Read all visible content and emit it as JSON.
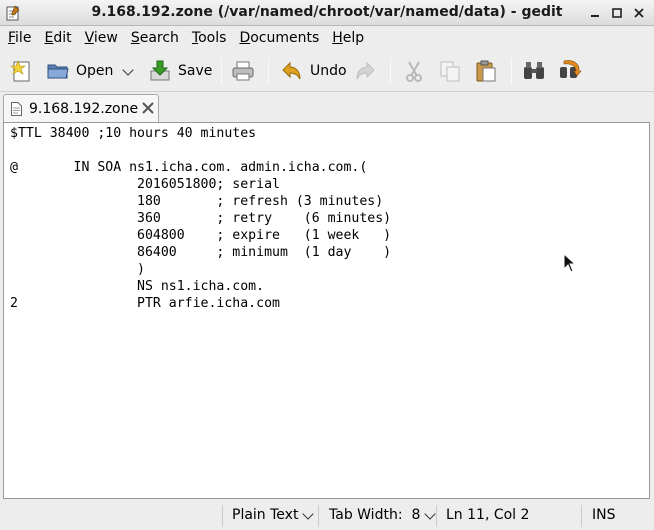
{
  "window": {
    "title": "9.168.192.zone (/var/named/chroot/var/named/data) - gedit"
  },
  "menu": [
    {
      "label": "File",
      "mnemonic": "F",
      "rest": "ile"
    },
    {
      "label": "Edit",
      "mnemonic": "E",
      "rest": "dit"
    },
    {
      "label": "View",
      "mnemonic": "V",
      "rest": "iew"
    },
    {
      "label": "Search",
      "mnemonic": "S",
      "rest": "earch"
    },
    {
      "label": "Tools",
      "mnemonic": "T",
      "rest": "ools"
    },
    {
      "label": "Documents",
      "mnemonic": "D",
      "rest": "ocuments"
    },
    {
      "label": "Help",
      "mnemonic": "H",
      "rest": "elp"
    }
  ],
  "toolbar": {
    "open_label": "Open",
    "save_label": "Save",
    "undo_label": "Undo"
  },
  "tab": {
    "label": "9.168.192.zone"
  },
  "editor": {
    "lines": [
      "$TTL 38400 ;10 hours 40 minutes",
      "",
      "@       IN SOA ns1.icha.com. admin.icha.com.(",
      "                2016051800; serial",
      "                180       ; refresh (3 minutes)",
      "                360       ; retry    (6 minutes)",
      "                604800    ; expire   (1 week   )",
      "                86400     ; minimum  (1 day    )",
      "                )",
      "                NS ns1.icha.com.",
      "2               PTR arfie.icha.com"
    ]
  },
  "status": {
    "language": "Plain Text",
    "tab_width": "Tab Width:  8",
    "position": "Ln 11, Col 2",
    "mode": "INS"
  },
  "colors": {
    "undo_arrow": "#e0a020",
    "save_arrow": "#3a9a2a",
    "new_star": "#f2d23a"
  }
}
